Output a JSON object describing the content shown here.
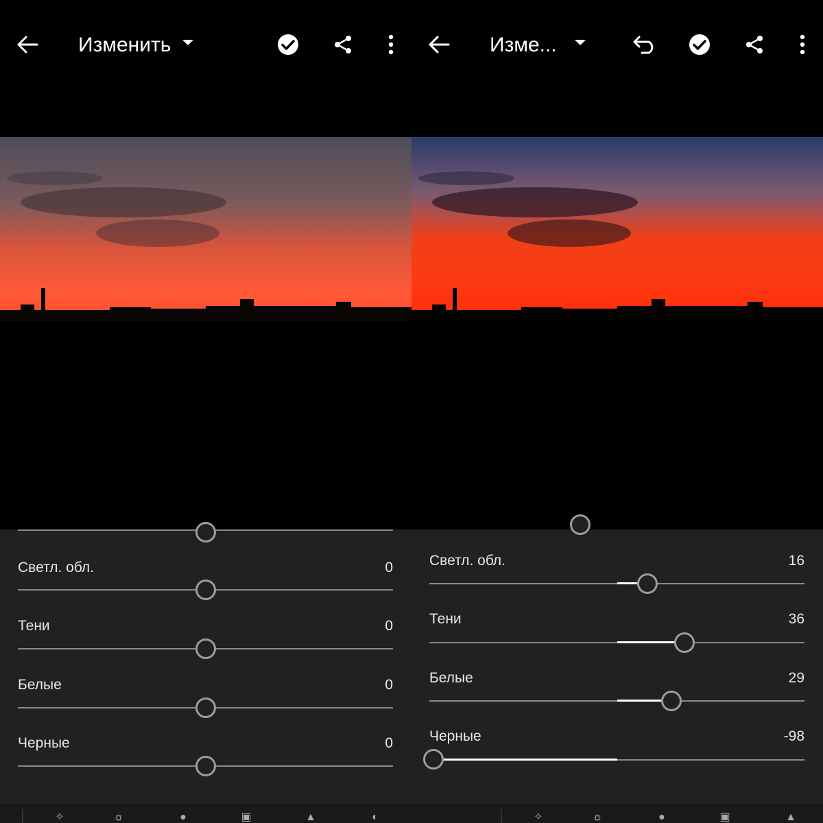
{
  "left": {
    "toolbar": {
      "title": "Изменить"
    },
    "panel": {
      "rows": [
        {
          "label": "Светл. обл.",
          "value": "0"
        },
        {
          "label": "Тени",
          "value": "0"
        },
        {
          "label": "Белые",
          "value": "0"
        },
        {
          "label": "Черные",
          "value": "0"
        }
      ]
    }
  },
  "right": {
    "toolbar": {
      "title": "Изме..."
    },
    "panel": {
      "rows": [
        {
          "label": "Светл. обл.",
          "value": "16"
        },
        {
          "label": "Тени",
          "value": "36"
        },
        {
          "label": "Белые",
          "value": "29"
        },
        {
          "label": "Черные",
          "value": "-98"
        }
      ]
    }
  },
  "icons": {
    "back": "back-arrow-icon",
    "dropdown": "chevron-down-icon",
    "undo": "undo-icon",
    "done": "checkmark-circle-icon",
    "share": "share-icon",
    "more": "more-vertical-icon"
  },
  "colors": {
    "background": "#000000",
    "panel": "#212121",
    "track": "#8a8a8a",
    "thumb": "#9c9c9c",
    "text": "#e8e8e8",
    "sunset_red": "#ff3a12",
    "sky_blue": "#36466e"
  }
}
